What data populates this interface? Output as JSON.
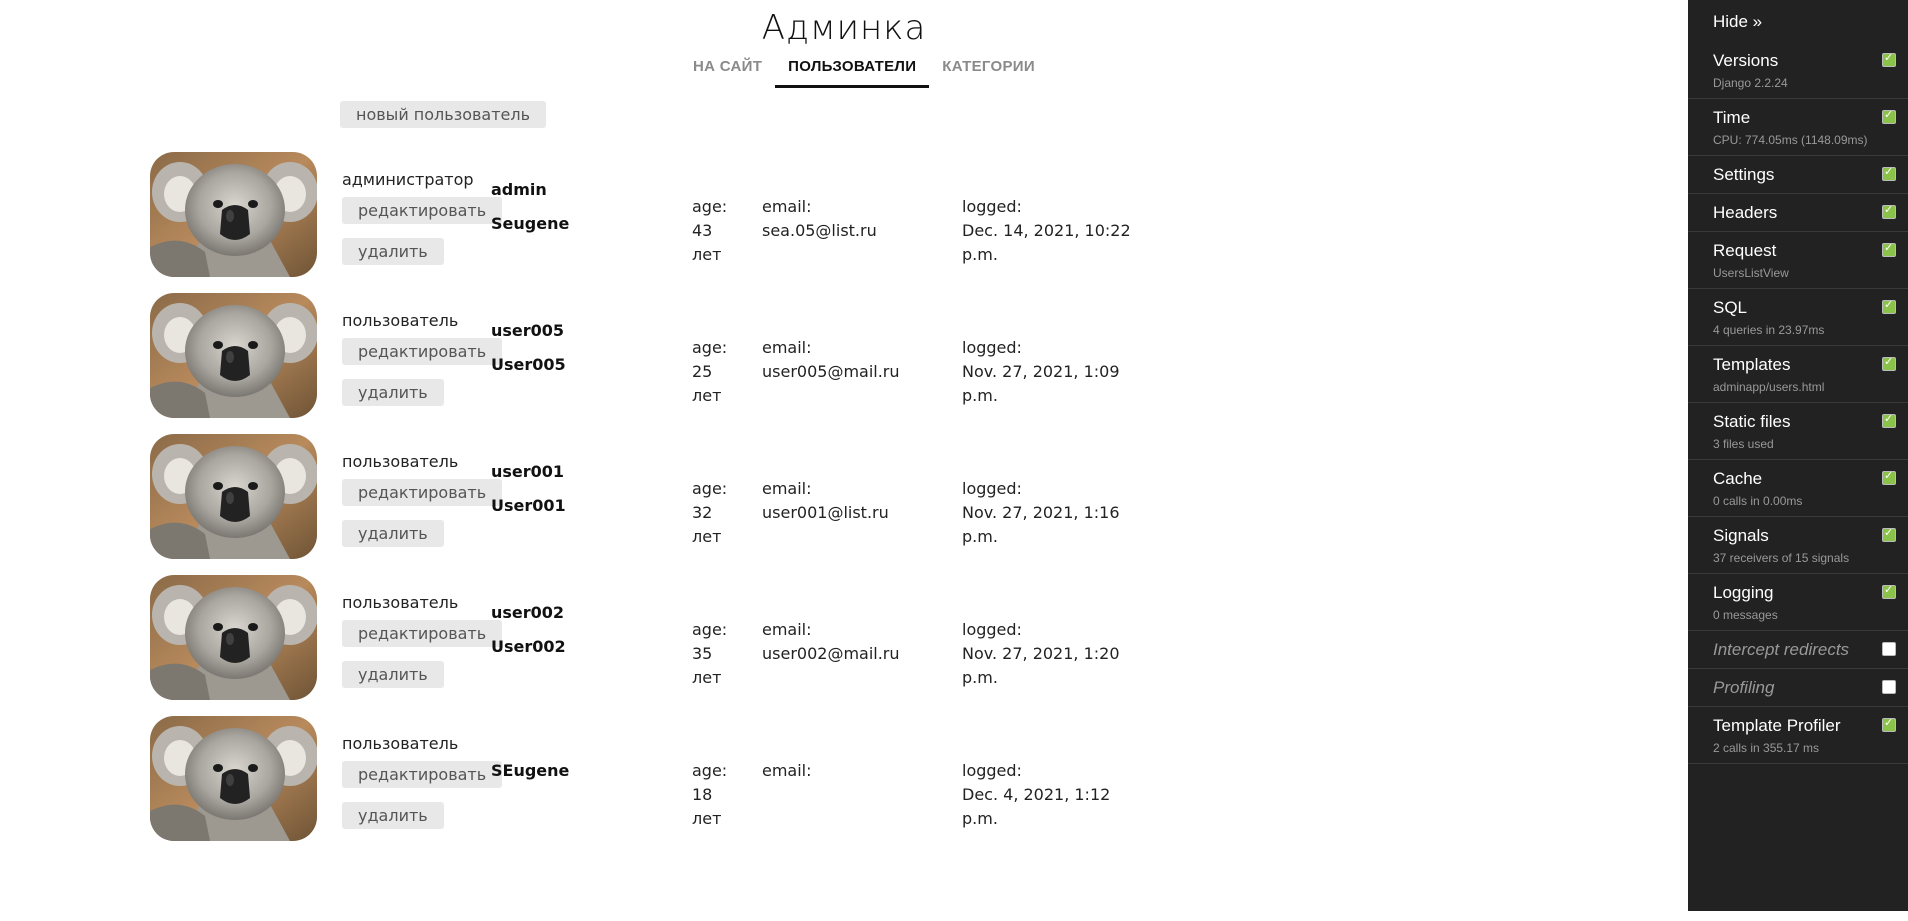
{
  "header": {
    "title": "Админка",
    "nav": [
      {
        "label": "на сайт",
        "active": false
      },
      {
        "label": "пользователи",
        "active": true
      },
      {
        "label": "категории",
        "active": false
      }
    ],
    "new_user_label": "новый пользователь"
  },
  "users": [
    {
      "role": "администратор",
      "username": "admin",
      "full_name": "Seugene",
      "age_label": "age:",
      "age": "43",
      "age_unit": "лет",
      "email_label": "email:",
      "email": "sea.05@list.ru",
      "logged_label": "logged:",
      "logged": "Dec. 14, 2021, 10:22 p.m.",
      "edit_label": "редактировать",
      "delete_label": "удалить"
    },
    {
      "role": "пользователь",
      "username": "user005",
      "full_name": "User005",
      "age_label": "age:",
      "age": "25",
      "age_unit": "лет",
      "email_label": "email:",
      "email": "user005@mail.ru",
      "logged_label": "logged:",
      "logged": "Nov. 27, 2021, 1:09 p.m.",
      "edit_label": "редактировать",
      "delete_label": "удалить"
    },
    {
      "role": "пользователь",
      "username": "user001",
      "full_name": "User001",
      "age_label": "age:",
      "age": "32",
      "age_unit": "лет",
      "email_label": "email:",
      "email": "user001@list.ru",
      "logged_label": "logged:",
      "logged": "Nov. 27, 2021, 1:16 p.m.",
      "edit_label": "редактировать",
      "delete_label": "удалить"
    },
    {
      "role": "пользователь",
      "username": "user002",
      "full_name": "User002",
      "age_label": "age:",
      "age": "35",
      "age_unit": "лет",
      "email_label": "email:",
      "email": "user002@mail.ru",
      "logged_label": "logged:",
      "logged": "Nov. 27, 2021, 1:20 p.m.",
      "edit_label": "редактировать",
      "delete_label": "удалить"
    },
    {
      "role": "пользователь",
      "username": "SEugene",
      "full_name": "",
      "age_label": "age:",
      "age": "18",
      "age_unit": "лет",
      "email_label": "email:",
      "email": "",
      "logged_label": "logged:",
      "logged": "Dec. 4, 2021, 1:12 p.m.",
      "edit_label": "редактировать",
      "delete_label": "удалить"
    }
  ],
  "debug_toolbar": {
    "hide_label": "Hide »",
    "panels": [
      {
        "title": "Versions",
        "subtitle": "Django 2.2.24",
        "checked": true,
        "enabled": true
      },
      {
        "title": "Time",
        "subtitle": "CPU: 774.05ms (1148.09ms)",
        "checked": true,
        "enabled": true
      },
      {
        "title": "Settings",
        "subtitle": "",
        "checked": true,
        "enabled": true
      },
      {
        "title": "Headers",
        "subtitle": "",
        "checked": true,
        "enabled": true
      },
      {
        "title": "Request",
        "subtitle": "UsersListView",
        "checked": true,
        "enabled": true
      },
      {
        "title": "SQL",
        "subtitle": "4 queries in 23.97ms",
        "checked": true,
        "enabled": true
      },
      {
        "title": "Templates",
        "subtitle": "adminapp/users.html",
        "checked": true,
        "enabled": true
      },
      {
        "title": "Static files",
        "subtitle": "3 files used",
        "checked": true,
        "enabled": true
      },
      {
        "title": "Cache",
        "subtitle": "0 calls in 0.00ms",
        "checked": true,
        "enabled": true
      },
      {
        "title": "Signals",
        "subtitle": "37 receivers of 15 signals",
        "checked": true,
        "enabled": true
      },
      {
        "title": "Logging",
        "subtitle": "0 messages",
        "checked": true,
        "enabled": true
      },
      {
        "title": "Intercept redirects",
        "subtitle": "",
        "checked": false,
        "enabled": false
      },
      {
        "title": "Profiling",
        "subtitle": "",
        "checked": false,
        "enabled": false
      },
      {
        "title": "Template Profiler",
        "subtitle": "2 calls in 355.17 ms",
        "checked": true,
        "enabled": true
      }
    ]
  },
  "colors": {
    "toolbar_bg": "#222222",
    "check_on": "#8bc34a",
    "button_bg": "#e8e8e8",
    "nav_active": "#111111",
    "nav_inactive": "#8a8a8a"
  }
}
